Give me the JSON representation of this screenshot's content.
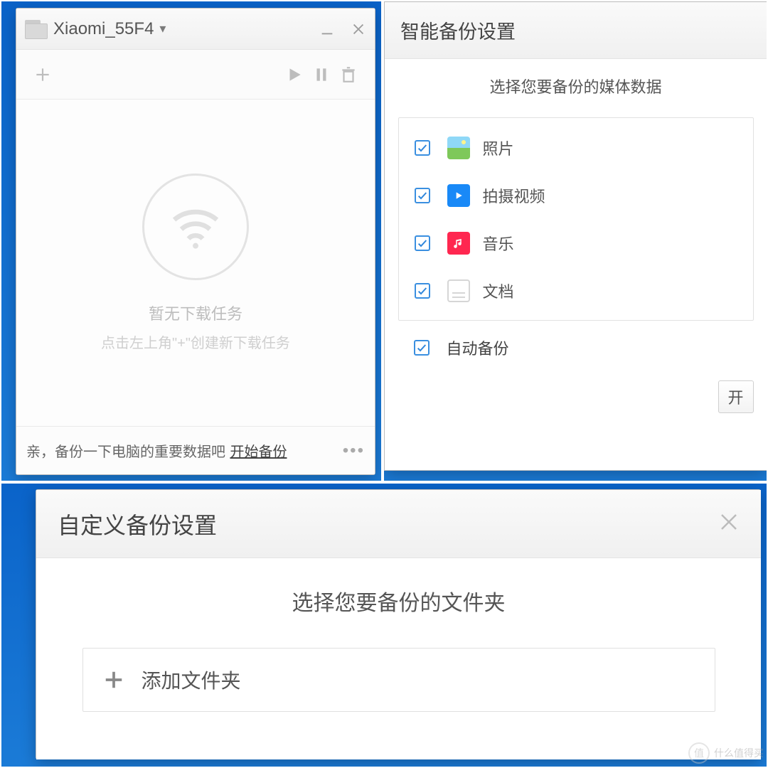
{
  "panelA": {
    "title": "Xiaomi_55F4",
    "empty_title": "暂无下载任务",
    "empty_sub": "点击左上角\"+\"创建新下载任务",
    "bottom_text": "亲，备份一下电脑的重要数据吧",
    "bottom_link": "开始备份"
  },
  "panelB": {
    "title": "智能备份设置",
    "heading": "选择您要备份的媒体数据",
    "items": [
      {
        "label": "照片"
      },
      {
        "label": "拍摄视频"
      },
      {
        "label": "音乐"
      },
      {
        "label": "文档"
      }
    ],
    "auto_label": "自动备份",
    "start_label": "开"
  },
  "panelC": {
    "title": "自定义备份设置",
    "heading": "选择您要备份的文件夹",
    "add_label": "添加文件夹"
  },
  "watermark": {
    "char": "值",
    "text": "什么值得买"
  }
}
